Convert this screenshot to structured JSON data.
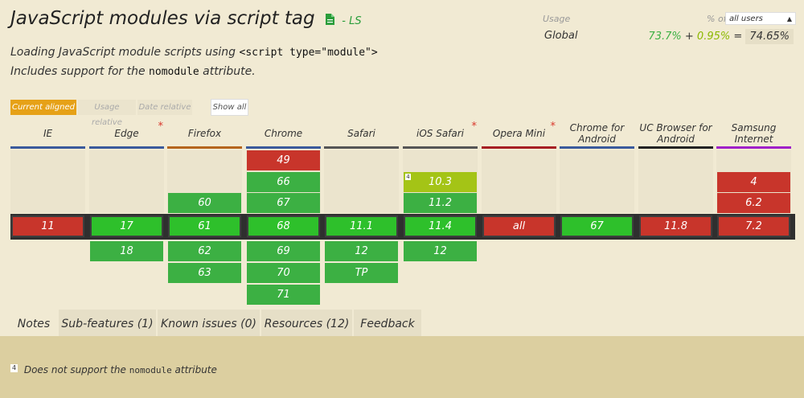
{
  "feature": {
    "title": "JavaScript modules via script tag",
    "spec_badge": "- LS",
    "desc_line1_pre": "Loading JavaScript module scripts using",
    "desc_line1_code": "<script type=\"module\">",
    "desc_line2_pre": "Includes support for the",
    "desc_line2_code": "nomodule",
    "desc_line2_post": "attribute."
  },
  "usage": {
    "label": "Usage",
    "scope": "Global",
    "pct_of_label": "% of",
    "select_value": "all users",
    "supported": "73.7%",
    "plus": "+",
    "partial": "0.95%",
    "equals": "=",
    "total": "74.65%"
  },
  "modes": {
    "current": "Current aligned",
    "usage_relative": "Usage relative",
    "date_relative": "Date relative",
    "show_all": "Show all"
  },
  "colors": {
    "supported": "#3cb043",
    "current_supported": "#2ec02b",
    "unsupported": "#c8352b",
    "partial": "#a4c416",
    "accent": "#e6a117"
  },
  "browsers": [
    {
      "name": "IE",
      "bar": "#3a5a9c",
      "star": "",
      "cells": [
        {
          "row": 3,
          "v": "11",
          "s": "n"
        }
      ]
    },
    {
      "name": "Edge",
      "bar": "#3a5a9c",
      "star": "*",
      "cells": [
        {
          "row": 3,
          "v": "17",
          "s": "y"
        },
        {
          "row": 4,
          "v": "18",
          "s": "y"
        }
      ]
    },
    {
      "name": "Firefox",
      "bar": "#b5651d",
      "star": "",
      "cells": [
        {
          "row": 2,
          "v": "60",
          "s": "y"
        },
        {
          "row": 3,
          "v": "61",
          "s": "y"
        },
        {
          "row": 4,
          "v": "62",
          "s": "y"
        },
        {
          "row": 5,
          "v": "63",
          "s": "y"
        }
      ]
    },
    {
      "name": "Chrome",
      "bar": "#3a5a9c",
      "star": "",
      "cells": [
        {
          "row": 0,
          "v": "49",
          "s": "n"
        },
        {
          "row": 1,
          "v": "66",
          "s": "y"
        },
        {
          "row": 2,
          "v": "67",
          "s": "y"
        },
        {
          "row": 3,
          "v": "68",
          "s": "y"
        },
        {
          "row": 4,
          "v": "69",
          "s": "y"
        },
        {
          "row": 5,
          "v": "70",
          "s": "y"
        },
        {
          "row": 6,
          "v": "71",
          "s": "y"
        }
      ]
    },
    {
      "name": "Safari",
      "bar": "#555555",
      "star": "",
      "cells": [
        {
          "row": 3,
          "v": "11.1",
          "s": "y"
        },
        {
          "row": 4,
          "v": "12",
          "s": "y"
        },
        {
          "row": 5,
          "v": "TP",
          "s": "y"
        }
      ]
    },
    {
      "name": "iOS Safari",
      "bar": "#555555",
      "star": "*",
      "cells": [
        {
          "row": 1,
          "v": "10.3",
          "s": "p",
          "note": "4"
        },
        {
          "row": 2,
          "v": "11.2",
          "s": "y"
        },
        {
          "row": 3,
          "v": "11.4",
          "s": "y"
        },
        {
          "row": 4,
          "v": "12",
          "s": "y"
        }
      ]
    },
    {
      "name": "Opera Mini",
      "bar": "#a61e22",
      "star": "*",
      "cells": [
        {
          "row": 3,
          "v": "all",
          "s": "n"
        }
      ]
    },
    {
      "name": "Chrome for Android",
      "bar": "#3a5a9c",
      "star": "",
      "cells": [
        {
          "row": 3,
          "v": "67",
          "s": "y"
        }
      ]
    },
    {
      "name": "UC Browser for Android",
      "bar": "#222222",
      "star": "",
      "cells": [
        {
          "row": 3,
          "v": "11.8",
          "s": "n"
        }
      ]
    },
    {
      "name": "Samsung Internet",
      "bar": "#a020c8",
      "star": "",
      "cells": [
        {
          "row": 1,
          "v": "4",
          "s": "n"
        },
        {
          "row": 2,
          "v": "6.2",
          "s": "n"
        },
        {
          "row": 3,
          "v": "7.2",
          "s": "n"
        }
      ]
    }
  ],
  "tabs": [
    {
      "label": "Notes",
      "active": true
    },
    {
      "label": "Sub-features (1)",
      "active": false
    },
    {
      "label": "Known issues (0)",
      "active": false
    },
    {
      "label": "Resources (12)",
      "active": false
    },
    {
      "label": "Feedback",
      "active": false
    }
  ],
  "notes": [
    {
      "num": "4",
      "pre": "Does not support the",
      "code": "nomodule",
      "post": "attribute"
    }
  ]
}
